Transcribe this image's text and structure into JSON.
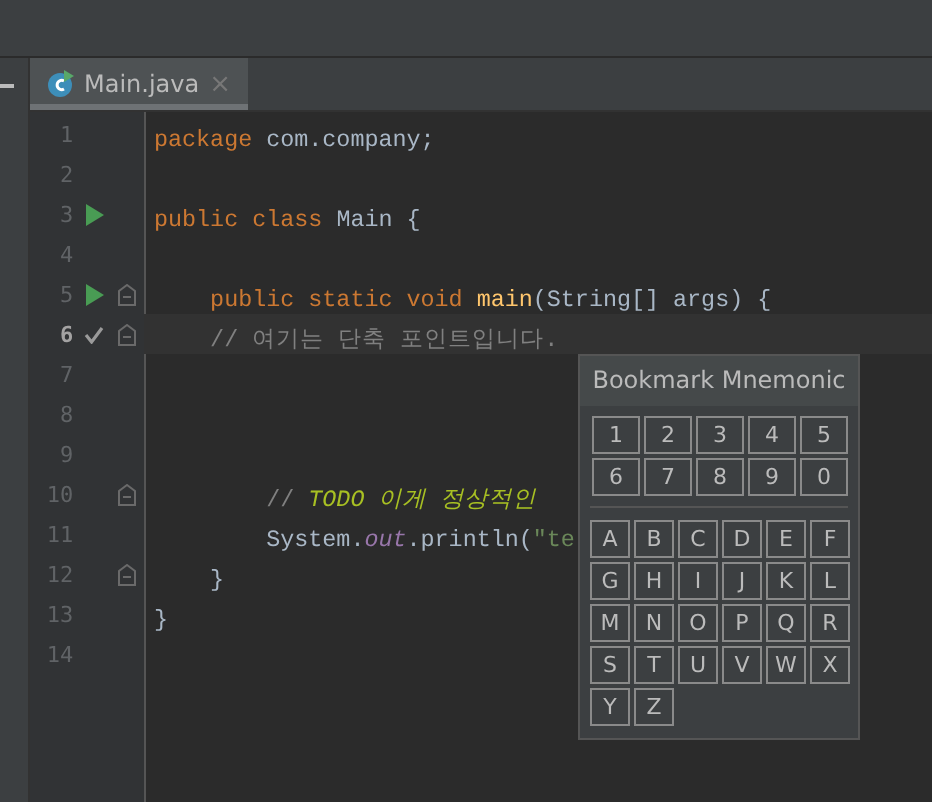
{
  "tabs": [
    {
      "label": "Main.java",
      "selected": true,
      "close": "×"
    }
  ],
  "lines": [
    {
      "number": "1",
      "kind": "plain",
      "fold": false,
      "current": false,
      "tokens": [
        {
          "kind": "keyword",
          "text": "package "
        },
        {
          "kind": "plain",
          "text": "com.company;"
        }
      ]
    },
    {
      "number": "2",
      "kind": "plain",
      "fold": false,
      "current": false
    },
    {
      "number": "3",
      "kind": "run",
      "fold": false,
      "current": false,
      "tokens": [
        {
          "kind": "keyword",
          "text": "public class "
        },
        {
          "kind": "plain",
          "text": "Main {"
        }
      ]
    },
    {
      "number": "4",
      "kind": "plain",
      "fold": false,
      "current": false
    },
    {
      "number": "5",
      "kind": "run",
      "fold": true,
      "current": false,
      "tokens": [
        {
          "kind": "keyword",
          "text": "    public static void "
        },
        {
          "kind": "method",
          "text": "main"
        },
        {
          "kind": "plain",
          "text": "(String[] args) {"
        }
      ]
    },
    {
      "number": "6",
      "kind": "check",
      "fold": true,
      "current": true,
      "tokens": [
        {
          "kind": "comment",
          "text": "    // 여기는 단축 포인트입니다."
        }
      ]
    },
    {
      "number": "7",
      "kind": "plain",
      "fold": false,
      "current": false
    },
    {
      "number": "8",
      "kind": "plain",
      "fold": false,
      "current": false
    },
    {
      "number": "9",
      "kind": "plain",
      "fold": false,
      "current": false
    },
    {
      "number": "10",
      "kind": "plain",
      "fold": true,
      "current": false,
      "tokens": [
        {
          "kind": "comment",
          "text": "        // "
        },
        {
          "kind": "todo",
          "text": "TODO 이게 정상적인"
        }
      ]
    },
    {
      "number": "11",
      "kind": "plain",
      "fold": false,
      "current": false,
      "tokens": [
        {
          "kind": "plain",
          "text": "        System."
        },
        {
          "kind": "field",
          "text": "out"
        },
        {
          "kind": "plain",
          "text": ".println("
        },
        {
          "kind": "string",
          "text": "\"te"
        }
      ]
    },
    {
      "number": "12",
      "kind": "plain",
      "fold": true,
      "current": false,
      "tokens": [
        {
          "kind": "plain",
          "text": "    }"
        }
      ]
    },
    {
      "number": "13",
      "kind": "plain",
      "fold": false,
      "current": false,
      "tokens": [
        {
          "kind": "plain",
          "text": "}"
        }
      ]
    },
    {
      "number": "14",
      "kind": "plain",
      "fold": false,
      "current": false
    }
  ],
  "popup": {
    "title": "Bookmark Mnemonic",
    "digits": [
      "1",
      "2",
      "3",
      "4",
      "5",
      "6",
      "7",
      "8",
      "9",
      "0"
    ],
    "letters": [
      "A",
      "B",
      "C",
      "D",
      "E",
      "F",
      "G",
      "H",
      "I",
      "J",
      "K",
      "L",
      "M",
      "N",
      "O",
      "P",
      "Q",
      "R",
      "S",
      "T",
      "U",
      "V",
      "W",
      "X",
      "Y",
      "Z"
    ]
  }
}
